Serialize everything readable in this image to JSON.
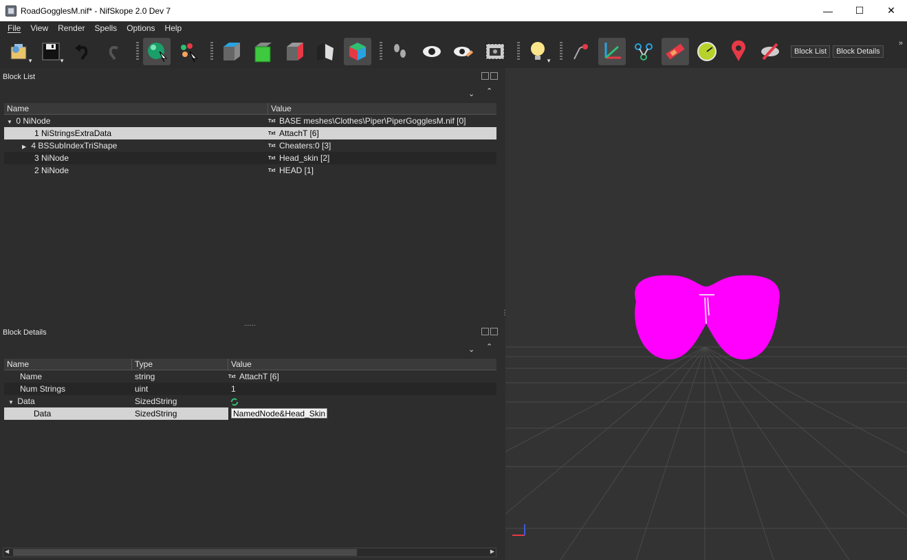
{
  "window": {
    "title": "RoadGogglesM.nif* - NifSkope 2.0 Dev 7",
    "minimize": "—",
    "maximize": "☐",
    "close": "✕"
  },
  "menu": [
    "File",
    "View",
    "Render",
    "Spells",
    "Options",
    "Help"
  ],
  "toolbar": {
    "block_list_button": "Block List",
    "block_details_button": "Block Details",
    "overflow": "»"
  },
  "block_list": {
    "title": "Block List",
    "columns": [
      "Name",
      "Value"
    ],
    "rows": [
      {
        "name": "0 NiNode",
        "value": "BASE meshes\\Clothes\\Piper\\PiperGogglesM.nif [0]",
        "expander": "▼"
      },
      {
        "name": "1 NiStringsExtraData",
        "value": "AttachT [6]",
        "expander": ""
      },
      {
        "name": "4 BSSubIndexTriShape",
        "value": "Cheaters:0 [3]",
        "expander": "▶"
      },
      {
        "name": "3 NiNode",
        "value": "Head_skin [2]",
        "expander": ""
      },
      {
        "name": "2 NiNode",
        "value": "HEAD [1]",
        "expander": ""
      }
    ],
    "txt_icon": "Txt"
  },
  "block_details": {
    "title": "Block Details",
    "columns": [
      "Name",
      "Type",
      "Value"
    ],
    "rows": [
      {
        "name": "Name",
        "type": "string",
        "value": "AttachT [6]",
        "expander": ""
      },
      {
        "name": "Num Strings",
        "type": "uint",
        "value": "1",
        "expander": ""
      },
      {
        "name": "Data",
        "type": "SizedString",
        "value": "",
        "expander": "▼"
      },
      {
        "name": "Data",
        "type": "SizedString",
        "value": "NamedNode&Head_Skin",
        "expander": ""
      }
    ]
  },
  "colors": {
    "mesh": "#ff00ff",
    "selection": "#d4d4d4",
    "background": "#2d2d2d"
  }
}
